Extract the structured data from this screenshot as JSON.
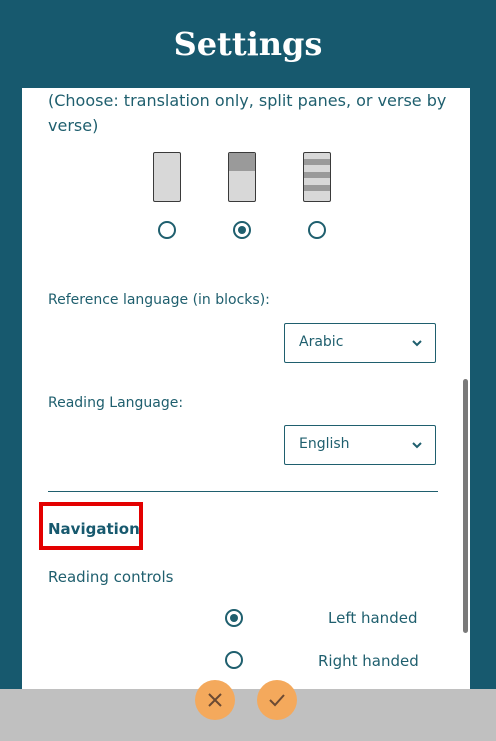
{
  "header": {
    "title": "Settings"
  },
  "layout": {
    "description": "(Choose: translation only, split panes, or verse by verse)",
    "options": [
      {
        "name": "translation-only",
        "selected": false
      },
      {
        "name": "split-panes",
        "selected": true
      },
      {
        "name": "verse-by-verse",
        "selected": false
      }
    ]
  },
  "reference_language": {
    "label": "Reference language (in blocks):",
    "value": "Arabic"
  },
  "reading_language": {
    "label": "Reading Language:",
    "value": "English"
  },
  "navigation": {
    "heading": "Navigation",
    "reading_controls_label": "Reading controls",
    "options": [
      {
        "label": "Left handed",
        "selected": true
      },
      {
        "label": "Right handed",
        "selected": false
      }
    ]
  },
  "footer": {
    "cancel_icon": "close-icon",
    "confirm_icon": "check-icon"
  },
  "colors": {
    "primary": "#17596e",
    "accent_button": "#f4a95c",
    "highlight": "#e30000",
    "footer_bg": "#c0c0c0"
  }
}
